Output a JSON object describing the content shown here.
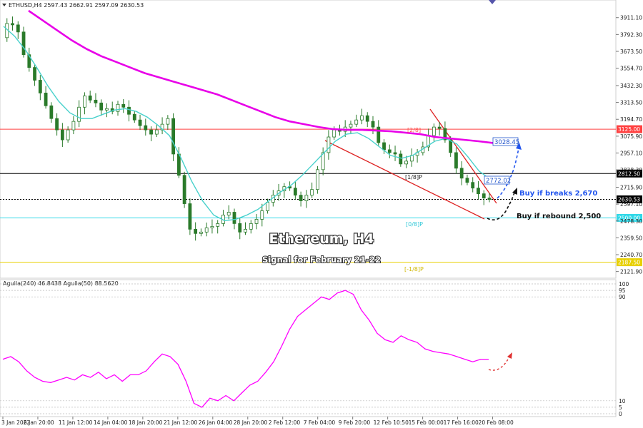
{
  "header": {
    "symbol_info": "ETHUSD,H4  2597.43 2662.91 2597.09 2630.53",
    "indicator_info": "Aguila(240) 46.8438  Aguila(50) 88.5620"
  },
  "overlay": {
    "title": "Ethereum, H4",
    "subtitle": "Signal for February 21-22",
    "buy_break": "Buy if breaks 2,670",
    "buy_rebound": "Buy if rebound 2,500"
  },
  "murray_labels": {
    "two_eighths": "[2/8]",
    "one_eighth": "[1/8]P",
    "zero_eighth": "[0/8]P",
    "minus_one_eighth": "[-1/8]P"
  },
  "price_boxes": {
    "ma200": "3028.45",
    "ma21": "2772.02"
  },
  "colors": {
    "ma200": "#e800e8",
    "ma21": "#48d1cc",
    "channel": "#dd2222",
    "level_red": "#ff6060",
    "level_cyan": "#30d8e8",
    "level_yellow": "#e8d000",
    "oscillator": "#ff00ff",
    "candle": "#2a7a2a"
  },
  "chart_data": {
    "type": "line",
    "price_axis": {
      "ticks": [
        "3911.10",
        "3792.30",
        "3673.50",
        "3554.70",
        "3432.30",
        "3313.50",
        "3194.70",
        "3075.90",
        "2957.10",
        "2838.30",
        "2715.90",
        "2597.10",
        "2478.30",
        "2359.50",
        "2240.70",
        "2121.90"
      ],
      "ylim": [
        2090,
        3960
      ],
      "level_boxes": [
        {
          "value": 3125.0,
          "label": "3125.00",
          "color": "#ff4040"
        },
        {
          "value": 2812.5,
          "label": "2812.50",
          "color": "#000000"
        },
        {
          "value": 2630.53,
          "label": "2630.53",
          "color": "#000000"
        },
        {
          "value": 2500.0,
          "label": "2500.00",
          "color": "#30d8e8"
        },
        {
          "value": 2187.5,
          "label": "2187.50",
          "color": "#e8d000"
        }
      ]
    },
    "x_axis": {
      "ticks": [
        "3 Jan 2022",
        "6 Jan 20:00",
        "11 Jan 12:00",
        "14 Jan 04:00",
        "18 Jan 20:00",
        "21 Jan 12:00",
        "26 Jan 04:00",
        "28 Jan 20:00",
        "2 Feb 12:00",
        "7 Feb 04:00",
        "9 Feb 20:00",
        "12 Feb 10:50",
        "15 Feb 00:00",
        "17 Feb 16:00",
        "20 Feb 08:00"
      ]
    },
    "price_series": [
      3770,
      3870,
      3860,
      3810,
      3650,
      3560,
      3470,
      3380,
      3290,
      3200,
      3120,
      3050,
      3120,
      3180,
      3280,
      3360,
      3330,
      3310,
      3260,
      3270,
      3250,
      3300,
      3280,
      3230,
      3190,
      3150,
      3120,
      3090,
      3120,
      3160,
      3200,
      2950,
      2800,
      2600,
      2420,
      2390,
      2400,
      2430,
      2440,
      2460,
      2520,
      2540,
      2460,
      2400,
      2420,
      2460,
      2490,
      2550,
      2610,
      2660,
      2690,
      2720,
      2710,
      2660,
      2620,
      2660,
      2700,
      2840,
      2960,
      3070,
      3120,
      3110,
      3140,
      3160,
      3190,
      3220,
      3180,
      3140,
      3030,
      2980,
      2960,
      2950,
      2880,
      2900,
      2940,
      2960,
      3000,
      3080,
      3140,
      3130,
      3050,
      2960,
      2850,
      2780,
      2750,
      2710,
      2670,
      2640,
      2630
    ],
    "ma200_series": [
      3960,
      3890,
      3820,
      3750,
      3690,
      3640,
      3600,
      3560,
      3520,
      3490,
      3460,
      3430,
      3400,
      3370,
      3330,
      3290,
      3250,
      3210,
      3180,
      3160,
      3140,
      3125,
      3120,
      3120,
      3115,
      3110,
      3100,
      3090,
      3070,
      3060,
      3050,
      3040,
      3028
    ],
    "ma21_series": [
      3850,
      3780,
      3680,
      3560,
      3430,
      3320,
      3240,
      3200,
      3200,
      3230,
      3260,
      3270,
      3250,
      3210,
      3150,
      3080,
      2930,
      2760,
      2620,
      2520,
      2480,
      2490,
      2520,
      2560,
      2620,
      2680,
      2730,
      2800,
      2880,
      2960,
      3040,
      3090,
      3100,
      3060,
      3000,
      2940,
      2920,
      2940,
      2990,
      3040,
      3060,
      3020,
      2930,
      2830,
      2772
    ],
    "oscillator": {
      "axis_ticks": [
        "100",
        "95",
        "90",
        "10",
        "5",
        "0"
      ],
      "ylim": [
        0,
        100
      ],
      "values": [
        42,
        44,
        40,
        33,
        28,
        25,
        24,
        26,
        28,
        26,
        30,
        28,
        32,
        27,
        30,
        25,
        30,
        30,
        33,
        40,
        46,
        44,
        38,
        25,
        8,
        5,
        12,
        10,
        14,
        10,
        16,
        22,
        25,
        32,
        40,
        52,
        65,
        75,
        80,
        85,
        90,
        88,
        93,
        95,
        92,
        80,
        72,
        62,
        57,
        55,
        60,
        57,
        55,
        50,
        48,
        47,
        46,
        44,
        42,
        40,
        42,
        42
      ]
    }
  }
}
